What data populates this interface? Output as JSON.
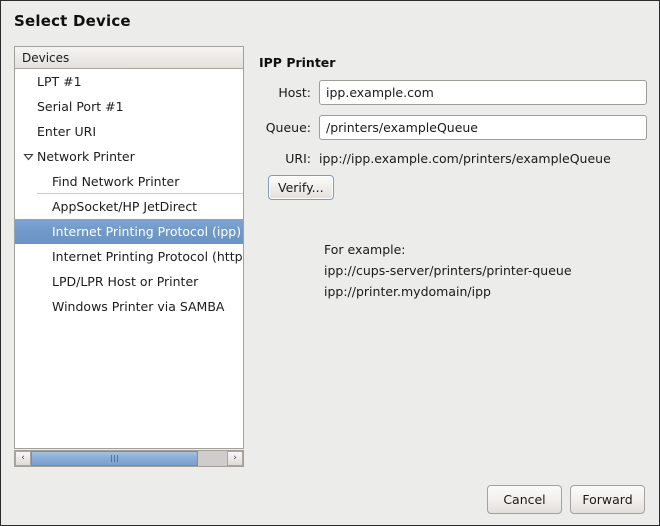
{
  "dialog": {
    "title": "Select Device"
  },
  "device_list": {
    "header": "Devices",
    "items": [
      {
        "label": "LPT #1",
        "level": 0,
        "expander": null,
        "selected": false,
        "separator_below": false
      },
      {
        "label": "Serial Port #1",
        "level": 0,
        "expander": null,
        "selected": false,
        "separator_below": false
      },
      {
        "label": "Enter URI",
        "level": 0,
        "expander": null,
        "selected": false,
        "separator_below": false
      },
      {
        "label": "Network Printer",
        "level": 0,
        "expander": "expanded",
        "selected": false,
        "separator_below": false
      },
      {
        "label": "Find Network Printer",
        "level": 1,
        "expander": null,
        "selected": false,
        "separator_below": true
      },
      {
        "label": "AppSocket/HP JetDirect",
        "level": 1,
        "expander": null,
        "selected": false,
        "separator_below": false
      },
      {
        "label": "Internet Printing Protocol (ipp)",
        "level": 1,
        "expander": null,
        "selected": true,
        "separator_below": false
      },
      {
        "label": "Internet Printing Protocol (https)",
        "level": 1,
        "expander": null,
        "selected": false,
        "separator_below": false
      },
      {
        "label": "LPD/LPR Host or Printer",
        "level": 1,
        "expander": null,
        "selected": false,
        "separator_below": false
      },
      {
        "label": "Windows Printer via SAMBA",
        "level": 1,
        "expander": null,
        "selected": false,
        "separator_below": false
      }
    ],
    "scrollbar": {
      "left_arrow": "‹",
      "right_arrow": "›",
      "thumb_grip": "|||"
    }
  },
  "details": {
    "panel_title": "IPP Printer",
    "host": {
      "label": "Host:",
      "value": "ipp.example.com"
    },
    "queue": {
      "label": "Queue:",
      "value": "/printers/exampleQueue"
    },
    "uri": {
      "label": "URI:",
      "value": "ipp://ipp.example.com/printers/exampleQueue"
    },
    "verify_label": "Verify...",
    "example": {
      "heading": "For example:",
      "line1": "ipp://cups-server/printers/printer-queue",
      "line2": "ipp://printer.mydomain/ipp"
    }
  },
  "footer": {
    "cancel_label": "Cancel",
    "forward_label": "Forward"
  },
  "colors": {
    "selection": "#7099c9",
    "dialog_background": "#ececea",
    "scroll_thumb": "#8badd6"
  }
}
